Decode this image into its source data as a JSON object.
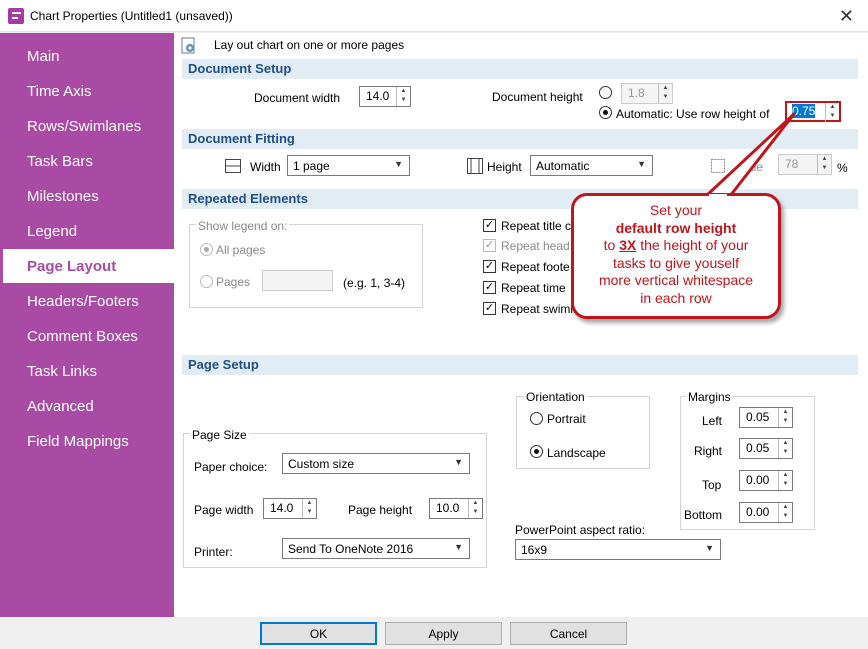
{
  "window": {
    "title": "Chart Properties (Untitled1 (unsaved))",
    "close_glyph": "✕"
  },
  "sidebar": {
    "items": [
      {
        "label": "Main"
      },
      {
        "label": "Time Axis"
      },
      {
        "label": "Rows/Swimlanes"
      },
      {
        "label": "Task Bars"
      },
      {
        "label": "Milestones"
      },
      {
        "label": "Legend"
      },
      {
        "label": "Page Layout",
        "active": true
      },
      {
        "label": "Headers/Footers"
      },
      {
        "label": "Comment Boxes"
      },
      {
        "label": "Task Links"
      },
      {
        "label": "Advanced"
      },
      {
        "label": "Field Mappings"
      }
    ]
  },
  "intro": {
    "text": "Lay out chart on one or more pages",
    "icon": "gear-page-icon"
  },
  "document_setup": {
    "header": "Document Setup",
    "width_label": "Document width",
    "width_value": "14.0",
    "height_label": "Document height",
    "height_manual_value": "1.8",
    "height_auto_label": "Automatic: Use row height of",
    "row_height_value": "0.75"
  },
  "document_fitting": {
    "header": "Document Fitting",
    "width_label": "Width",
    "width_value": "1 page",
    "height_label": "Height",
    "height_value": "Automatic",
    "scale_label": "Scale",
    "scale_visible_fragment": "ale",
    "scale_value": "78",
    "percent": "%"
  },
  "repeated_elements": {
    "header": "Repeated Elements",
    "show_legend_label": "Show legend on:",
    "all_pages_label": "All pages",
    "pages_label": "Pages",
    "pages_hint": "(e.g. 1, 3-4)",
    "checkboxes": [
      {
        "label": "Repeat title c",
        "checked": true,
        "enabled": true
      },
      {
        "label": "Repeat head",
        "checked": true,
        "enabled": false
      },
      {
        "label": "Repeat foote",
        "checked": true,
        "enabled": true
      },
      {
        "label": "Repeat time",
        "checked": true,
        "enabled": true
      },
      {
        "label": "Repeat swimla",
        "checked": true,
        "enabled": true
      }
    ]
  },
  "callout": {
    "line1": "Set your",
    "line2": "default row height",
    "line3_pre": "to ",
    "line3_emph": "3X",
    "line3_post": " the height of your",
    "line4": "tasks to give youself",
    "line5": "more vertical whitespace",
    "line6": "in each row",
    "color": "#c0151b"
  },
  "page_setup": {
    "header": "Page Setup",
    "page_size_label": "Page Size",
    "paper_choice_label": "Paper choice:",
    "paper_choice_value": "Custom size",
    "page_width_label": "Page width",
    "page_width_value": "14.0",
    "page_height_label": "Page height",
    "page_height_value": "10.0",
    "printer_label": "Printer:",
    "printer_value": "Send To OneNote 2016",
    "orientation_label": "Orientation",
    "portrait_label": "Portrait",
    "landscape_label": "Landscape",
    "margins_label": "Margins",
    "margin_left_label": "Left",
    "margin_left_value": "0.05",
    "margin_right_label": "Right",
    "margin_right_value": "0.05",
    "margin_top_label": "Top",
    "margin_top_value": "0.00",
    "margin_bottom_label": "Bottom",
    "margin_bottom_value": "0.00",
    "ppt_ratio_label": "PowerPoint aspect ratio:",
    "ppt_ratio_value": "16x9"
  },
  "buttons": {
    "ok": "OK",
    "apply": "Apply",
    "cancel": "Cancel"
  },
  "colors": {
    "sidebar": "#a94aa4",
    "section_header_bg": "#e2ecf5",
    "section_header_text": "#1f4f8a",
    "focus": "#0078d7"
  }
}
